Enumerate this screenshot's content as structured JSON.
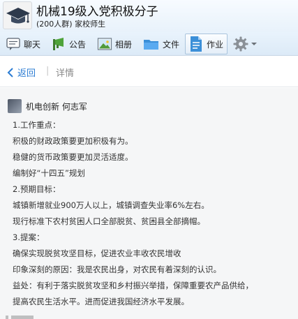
{
  "header": {
    "title": "机械19级入党积极分子",
    "subtitle": "(200人群) 家校师生"
  },
  "toolbar": {
    "items": [
      {
        "label": "聊天",
        "icon": "chat-icon"
      },
      {
        "label": "公告",
        "icon": "megaphone-icon"
      },
      {
        "label": "相册",
        "icon": "photo-icon"
      },
      {
        "label": "文件",
        "icon": "folder-icon"
      },
      {
        "label": "作业",
        "icon": "homework-icon",
        "active": true
      }
    ],
    "settings_icon": "gear-icon"
  },
  "nav": {
    "back_label": "返回",
    "separator": "|",
    "detail_label": "详情"
  },
  "post": {
    "author": "机电创新 何志军",
    "lines": [
      "1.工作重点：",
      "积极的财政政策要更加积极有为。",
      "稳健的货币政策要更加灵活适度。",
      "编制好“十四五”规划",
      "2.预期目标：",
      "城镇新增就业900万人以上，城镇调查失业率6%左右。",
      "现行标准下农村贫困人口全部脱贫、贫困县全部摘帽。",
      "3.提案：",
      "确保实现脱贫攻坚目标，促进农业丰收农民增收",
      "印象深刻的原因：我是农民出身，对农民有着深刻的认识。",
      "益处：有利于落实脱贫攻坚和乡村振兴举措，保障重要农产品供给，",
      "提高农民生活水平。进而促进我国经济水平发展。"
    ]
  },
  "colors": {
    "accent": "#2b7cd3",
    "toolbar_bg": "#dceaf7",
    "content_bg": "#f5f6f7"
  }
}
